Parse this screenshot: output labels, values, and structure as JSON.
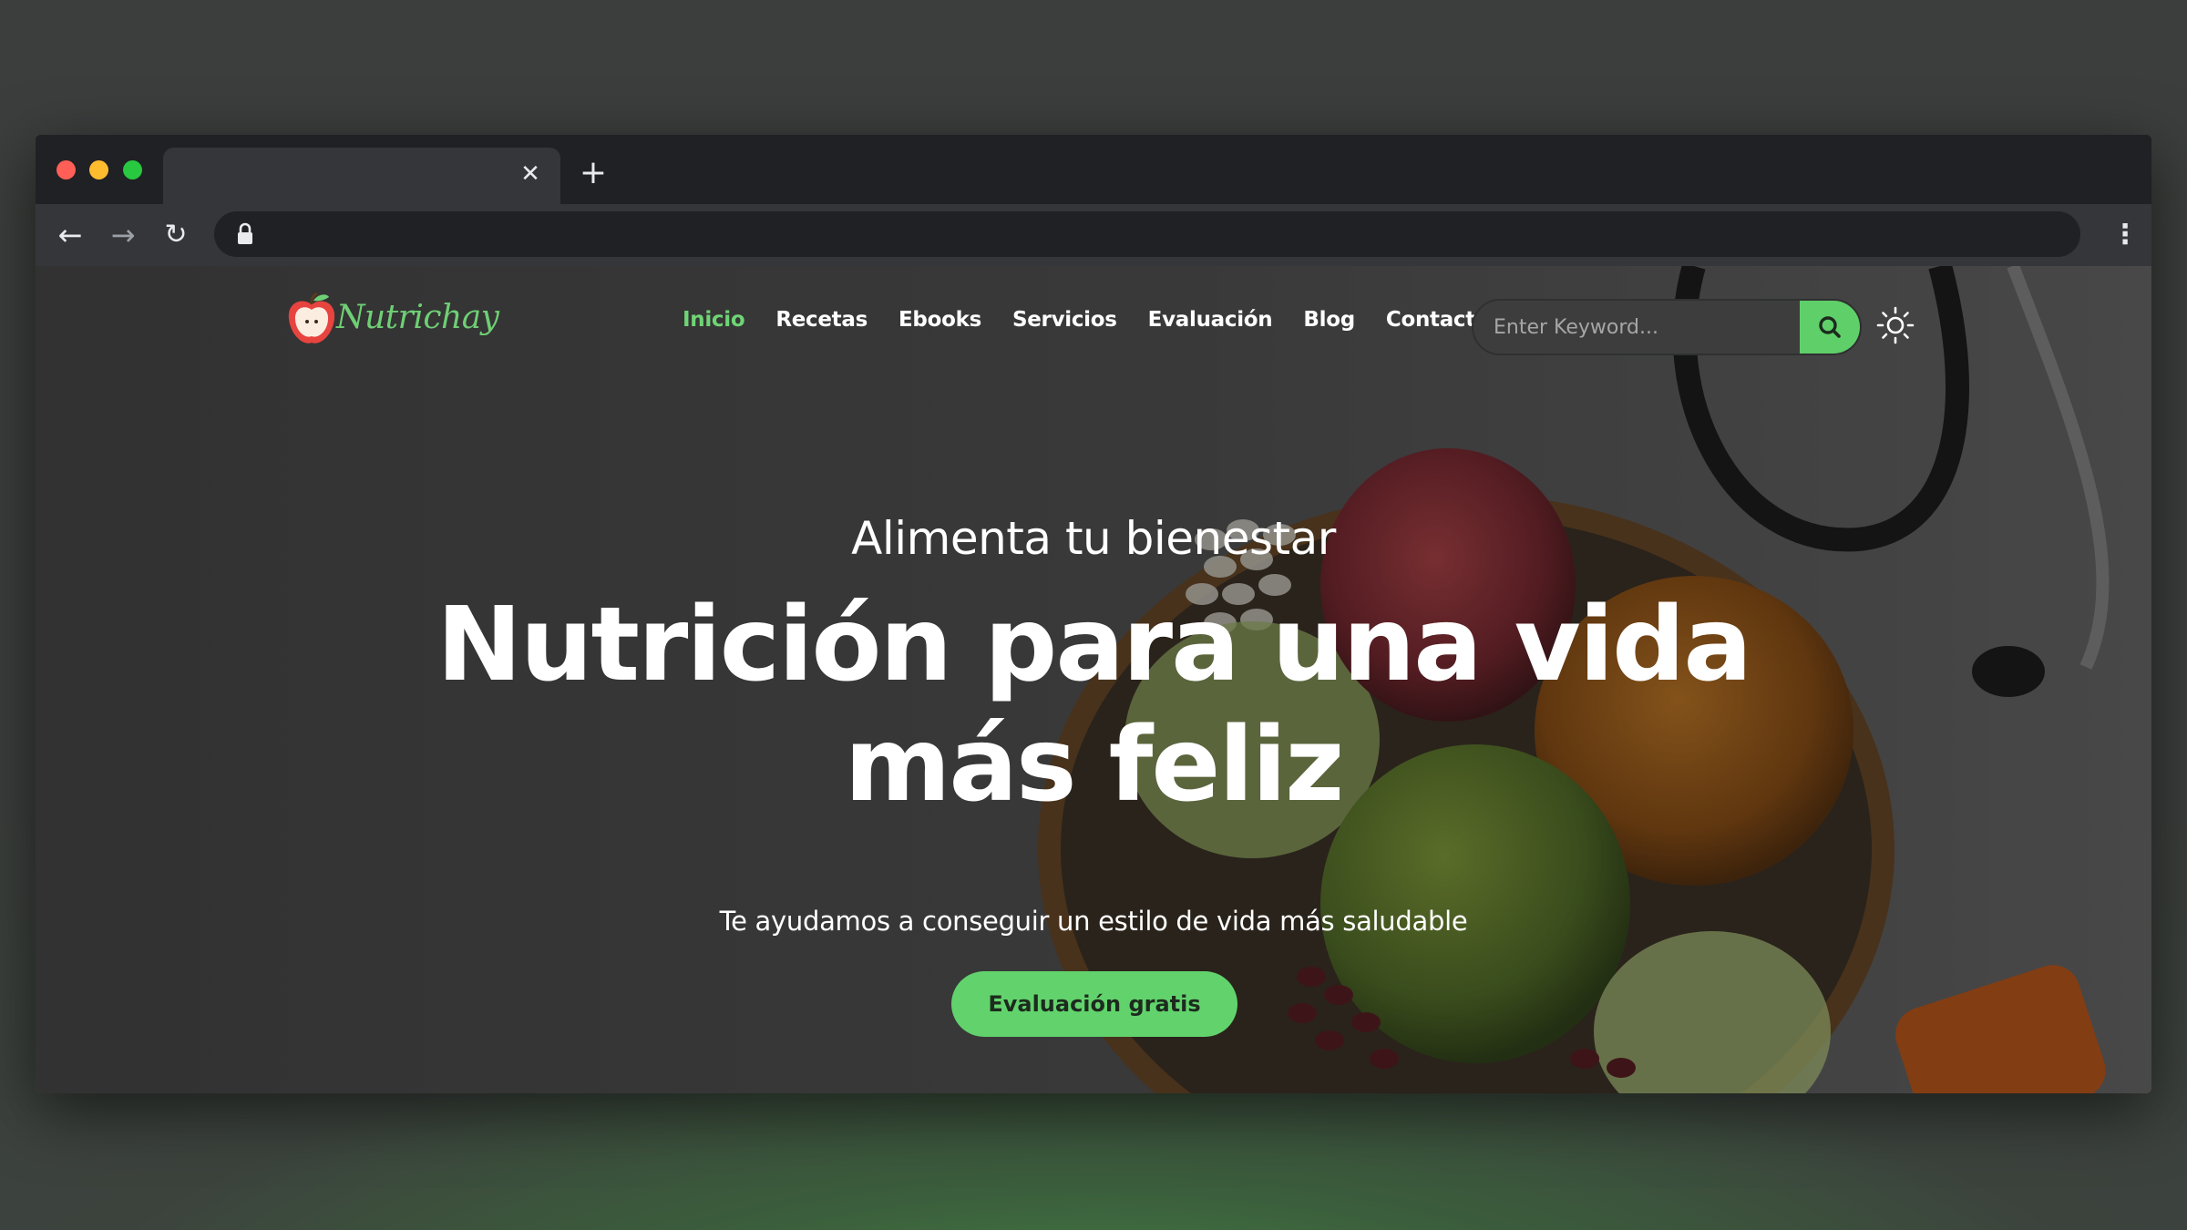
{
  "browser": {
    "tab_close_glyph": "✕",
    "new_tab_glyph": "+",
    "back_glyph": "←",
    "forward_glyph": "→",
    "reload_glyph": "↻",
    "menu_glyph": "⋮",
    "icons": [
      "lock-icon",
      "kebab-menu-icon"
    ]
  },
  "site": {
    "logo_text": "Nutrichay",
    "colors": {
      "accent": "#62d36c",
      "nav_active": "#6fd475"
    }
  },
  "nav": {
    "items": [
      {
        "label": "Inicio",
        "active": true
      },
      {
        "label": "Recetas"
      },
      {
        "label": "Ebooks"
      },
      {
        "label": "Servicios"
      },
      {
        "label": "Evaluación"
      },
      {
        "label": "Blog"
      },
      {
        "label": "Contacto"
      }
    ]
  },
  "search": {
    "placeholder": "Enter Keyword...",
    "value": "",
    "icon": "search-icon"
  },
  "theme_toggle": {
    "icon": "sun-icon"
  },
  "hero": {
    "subtitle": "Alimenta tu bienestar",
    "title": "Nutrición para una vida más feliz",
    "description": "Te ayudamos a conseguir un estilo de vida más saludable",
    "cta_label": "Evaluación gratis"
  }
}
